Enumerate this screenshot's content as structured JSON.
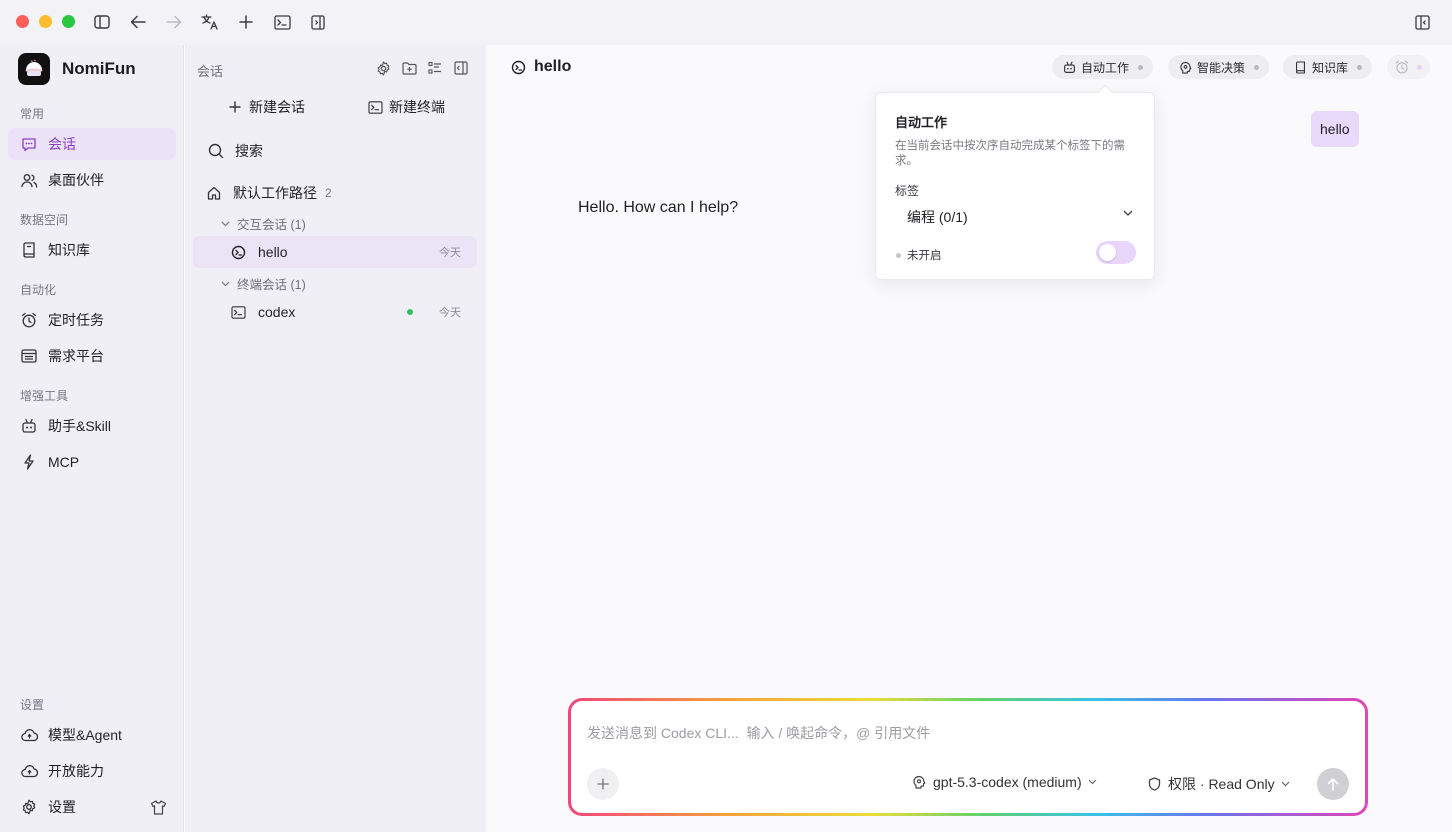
{
  "colors": {
    "accent": "#8a3fc7",
    "active_bg": "#ebe2f7",
    "user_bubble": "#e9d9fb",
    "online": "#2fc25b",
    "close": "#ff5f57",
    "minimize": "#febc2e",
    "zoom": "#28c840"
  },
  "app": {
    "name": "NomiFun"
  },
  "sidebar": {
    "sections": [
      {
        "label": "常用",
        "items": [
          {
            "label": "会话",
            "icon": "chat-icon",
            "active": true
          },
          {
            "label": "桌面伙伴",
            "icon": "users-icon"
          }
        ]
      },
      {
        "label": "数据空间",
        "items": [
          {
            "label": "知识库",
            "icon": "book-icon"
          }
        ]
      },
      {
        "label": "自动化",
        "items": [
          {
            "label": "定时任务",
            "icon": "alarm-icon"
          },
          {
            "label": "需求平台",
            "icon": "list-icon"
          }
        ]
      },
      {
        "label": "增强工具",
        "items": [
          {
            "label": "助手&Skill",
            "icon": "robot-icon"
          },
          {
            "label": "MCP",
            "icon": "bolt-icon"
          }
        ]
      }
    ],
    "bottom_label": "设置",
    "bottom_items": [
      {
        "label": "模型&Agent",
        "icon": "cloud-icon"
      },
      {
        "label": "开放能力",
        "icon": "cloud-icon"
      },
      {
        "label": "设置",
        "icon": "gear-icon"
      }
    ]
  },
  "panel": {
    "title": "会话",
    "new_chat": "新建会话",
    "new_terminal": "新建终端",
    "search": "搜索",
    "workspace": {
      "label": "默认工作路径",
      "count": "2"
    },
    "groups": [
      {
        "label": "交互会话 (1)",
        "sessions": [
          {
            "name": "hello",
            "time": "今天",
            "active": true
          }
        ]
      },
      {
        "label": "终端会话 (1)",
        "sessions": [
          {
            "name": "codex",
            "time": "今天",
            "online": true
          }
        ]
      }
    ]
  },
  "main": {
    "title": "hello",
    "chips": [
      "自动工作",
      "智能决策",
      "知识库"
    ],
    "user_message": "hello",
    "assistant_message": "Hello. How can I help?"
  },
  "popover": {
    "title": "自动工作",
    "description": "在当前会话中按次序自动完成某个标签下的需求。",
    "label": "标签",
    "select_value": "编程 (0/1)",
    "status": "未开启",
    "enabled": false
  },
  "composer": {
    "placeholder": "发送消息到 Codex CLI...  输入 / 唤起命令，@ 引用文件",
    "value": "",
    "model": "gpt-5.3-codex (medium)",
    "permission": "权限 · Read Only"
  }
}
